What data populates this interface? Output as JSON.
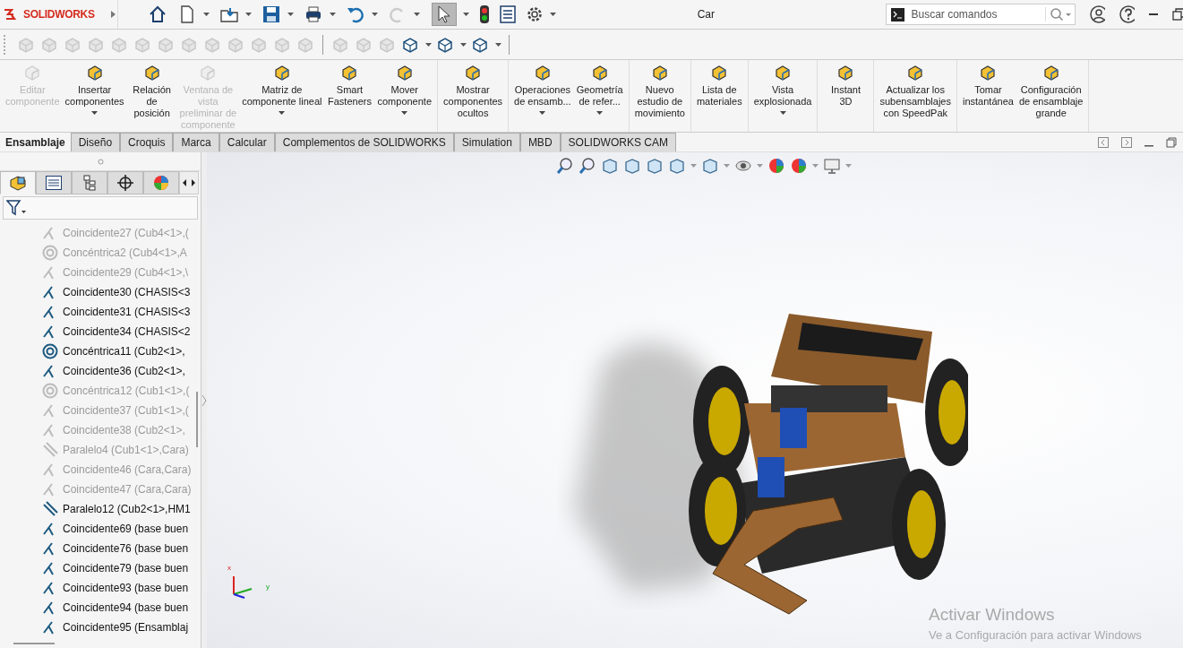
{
  "app": {
    "logo": "SOLIDWORKS",
    "document_title": "Car"
  },
  "search": {
    "placeholder": "Buscar comandos"
  },
  "feature_tools": [
    [
      {
        "disabled": true
      },
      {
        "disabled": true
      },
      {
        "disabled": true
      },
      {
        "disabled": true
      },
      {
        "disabled": true
      },
      {
        "disabled": true
      },
      {
        "disabled": true
      },
      {
        "disabled": true
      },
      {
        "disabled": true
      },
      {
        "disabled": true
      },
      {
        "disabled": true
      },
      {
        "disabled": true
      },
      {
        "disabled": true
      }
    ],
    [
      {
        "disabled": true
      },
      {
        "disabled": true
      },
      {
        "disabled": true
      },
      {
        "disabled": false,
        "dropdown": true
      },
      {
        "disabled": false,
        "dropdown": true
      },
      {
        "disabled": false,
        "dropdown": true
      }
    ]
  ],
  "ribbon": [
    [
      {
        "label": "Editar\ncomponente",
        "disabled": true,
        "dropdown": false
      },
      {
        "label": "Insertar\ncomponentes",
        "disabled": false,
        "dropdown": true
      },
      {
        "label": "Relación\nde\nposición",
        "disabled": false,
        "dropdown": false
      },
      {
        "label": "Ventana de\nvista\npreliminar de\ncomponente",
        "disabled": true,
        "dropdown": false
      },
      {
        "label": "Matriz de\ncomponente lineal",
        "disabled": false,
        "dropdown": true
      },
      {
        "label": "Smart\nFasteners",
        "disabled": false,
        "dropdown": false
      },
      {
        "label": "Mover\ncomponente",
        "disabled": false,
        "dropdown": true
      }
    ],
    [
      {
        "label": "Mostrar\ncomponentes\nocultos",
        "disabled": false,
        "dropdown": false
      }
    ],
    [
      {
        "label": "Operaciones\nde ensamb...",
        "disabled": false,
        "dropdown": true
      },
      {
        "label": "Geometría\nde refer...",
        "disabled": false,
        "dropdown": true
      }
    ],
    [
      {
        "label": "Nuevo\nestudio de\nmovimiento",
        "disabled": false,
        "dropdown": false
      }
    ],
    [
      {
        "label": "Lista de\nmateriales",
        "disabled": false,
        "dropdown": false
      }
    ],
    [
      {
        "label": "Vista\nexplosionada",
        "disabled": false,
        "dropdown": true
      }
    ],
    [
      {
        "label": "Instant\n3D",
        "disabled": false,
        "dropdown": false
      }
    ],
    [
      {
        "label": "Actualizar los\nsubensamblajes\ncon SpeedPak",
        "disabled": false,
        "dropdown": false
      }
    ],
    [
      {
        "label": "Tomar\ninstantánea",
        "disabled": false,
        "dropdown": false
      },
      {
        "label": "Configuración\nde ensamblaje\ngrande",
        "disabled": false,
        "dropdown": false
      }
    ]
  ],
  "tabs": [
    {
      "label": "Ensamblaje",
      "selected": true
    },
    {
      "label": "Diseño",
      "selected": false
    },
    {
      "label": "Croquis",
      "selected": false
    },
    {
      "label": "Marca",
      "selected": false
    },
    {
      "label": "Calcular",
      "selected": false
    },
    {
      "label": "Complementos de SOLIDWORKS",
      "selected": false
    },
    {
      "label": "Simulation",
      "selected": false
    },
    {
      "label": "MBD",
      "selected": false
    },
    {
      "label": "SOLIDWORKS CAM",
      "selected": false
    }
  ],
  "panel_tabs": [
    {
      "selected": true
    },
    {
      "selected": false
    },
    {
      "selected": false
    },
    {
      "selected": false
    },
    {
      "selected": false
    }
  ],
  "mates": [
    {
      "kind": "coincident",
      "label": "Coincidente27 (Cub4<1>,(",
      "suppressed": true
    },
    {
      "kind": "concentric",
      "label": "Concéntrica2 (Cub4<1>,A",
      "suppressed": true
    },
    {
      "kind": "coincident",
      "label": "Coincidente29 (Cub4<1>,\\",
      "suppressed": true
    },
    {
      "kind": "coincident",
      "label": "Coincidente30 (CHASIS<3",
      "suppressed": false
    },
    {
      "kind": "coincident",
      "label": "Coincidente31 (CHASIS<3",
      "suppressed": false
    },
    {
      "kind": "coincident",
      "label": "Coincidente34 (CHASIS<2",
      "suppressed": false
    },
    {
      "kind": "concentric",
      "label": "Concéntrica11 (Cub2<1>,",
      "suppressed": false
    },
    {
      "kind": "coincident",
      "label": "Coincidente36 (Cub2<1>,",
      "suppressed": false
    },
    {
      "kind": "concentric",
      "label": "Concéntrica12 (Cub1<1>,(",
      "suppressed": true
    },
    {
      "kind": "coincident",
      "label": "Coincidente37 (Cub1<1>,(",
      "suppressed": true
    },
    {
      "kind": "coincident",
      "label": "Coincidente38 (Cub2<1>,",
      "suppressed": true
    },
    {
      "kind": "parallel",
      "label": "Paralelo4 (Cub1<1>,Cara)",
      "suppressed": true
    },
    {
      "kind": "coincident",
      "label": "Coincidente46 (Cara,Cara)",
      "suppressed": true
    },
    {
      "kind": "coincident",
      "label": "Coincidente47 (Cara,Cara)",
      "suppressed": true
    },
    {
      "kind": "parallel",
      "label": "Paralelo12 (Cub2<1>,HM1",
      "suppressed": false
    },
    {
      "kind": "coincident",
      "label": "Coincidente69 (base buen",
      "suppressed": false
    },
    {
      "kind": "coincident",
      "label": "Coincidente76 (base buen",
      "suppressed": false
    },
    {
      "kind": "coincident",
      "label": "Coincidente79 (base buen",
      "suppressed": false
    },
    {
      "kind": "coincident",
      "label": "Coincidente93 (base buen",
      "suppressed": false
    },
    {
      "kind": "coincident",
      "label": "Coincidente94 (base buen",
      "suppressed": false
    },
    {
      "kind": "coincident",
      "label": "Coincidente95 (Ensamblaj",
      "suppressed": false
    }
  ],
  "triad": {
    "x": "x",
    "y": "y"
  },
  "os_notice": {
    "title": "Activar Windows",
    "text": "Ve a Configuración para activar Windows"
  }
}
